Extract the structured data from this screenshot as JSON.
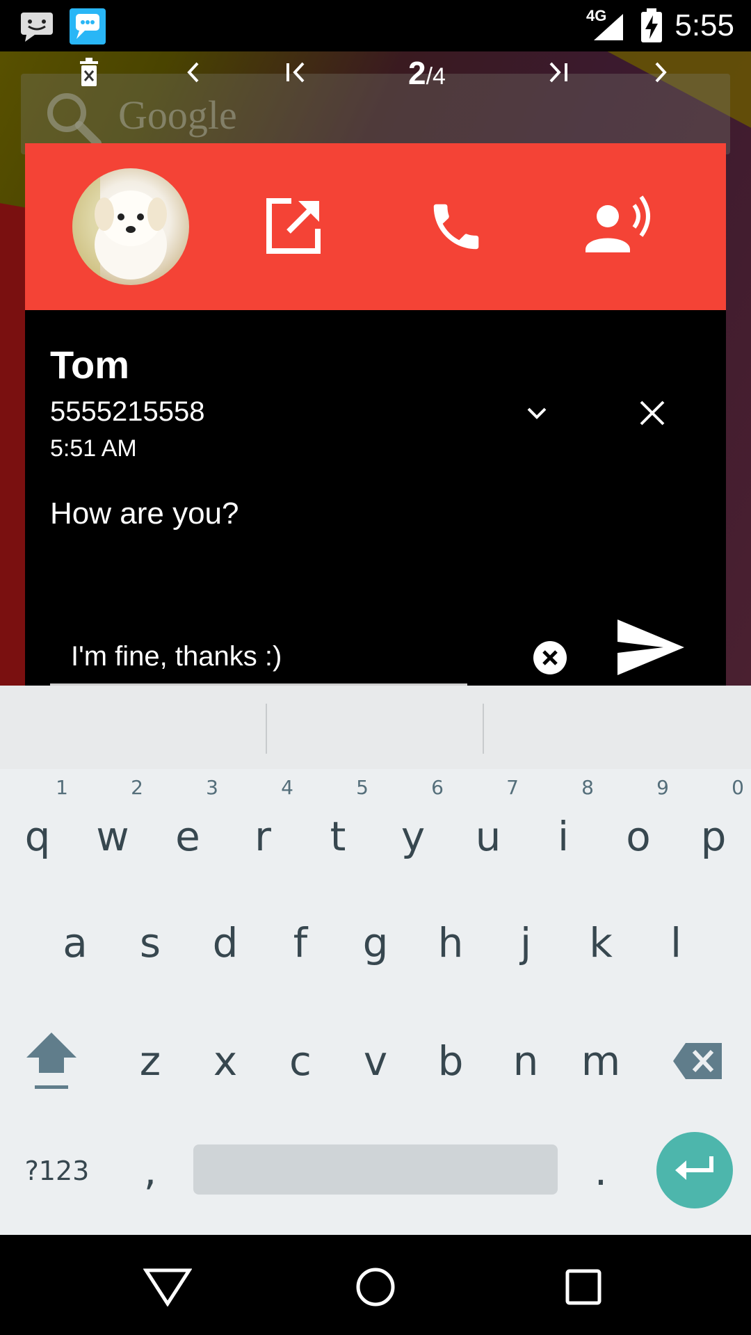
{
  "status_bar": {
    "time": "5:55",
    "network": "4G",
    "icons": [
      "sms-notification-icon",
      "messenger-notification-icon",
      "signal-icon",
      "battery-charging-icon"
    ]
  },
  "background": {
    "search_widget_text": "Google"
  },
  "pager": {
    "current": "2",
    "separator_total": "/4",
    "icons": [
      "delete-icon",
      "previous-icon",
      "first-icon",
      "last-icon",
      "next-icon"
    ]
  },
  "card": {
    "header_color": "#f44336",
    "actions": [
      "avatar",
      "open-external-icon",
      "call-icon",
      "speak-icon"
    ],
    "sender_name": "Tom",
    "sender_number": "5555215558",
    "time": "5:51 AM",
    "message": "How are you?",
    "reply_value": "I'm fine, thanks :)"
  },
  "keyboard": {
    "row1": [
      {
        "ch": "q",
        "num": "1"
      },
      {
        "ch": "w",
        "num": "2"
      },
      {
        "ch": "e",
        "num": "3"
      },
      {
        "ch": "r",
        "num": "4"
      },
      {
        "ch": "t",
        "num": "5"
      },
      {
        "ch": "y",
        "num": "6"
      },
      {
        "ch": "u",
        "num": "7"
      },
      {
        "ch": "i",
        "num": "8"
      },
      {
        "ch": "o",
        "num": "9"
      },
      {
        "ch": "p",
        "num": "0"
      }
    ],
    "row2": [
      "a",
      "s",
      "d",
      "f",
      "g",
      "h",
      "j",
      "k",
      "l"
    ],
    "row3": [
      "z",
      "x",
      "c",
      "v",
      "b",
      "n",
      "m"
    ],
    "symbols_label": "?123",
    "comma": ",",
    "period": ".",
    "enter_color": "#4db6ac"
  }
}
